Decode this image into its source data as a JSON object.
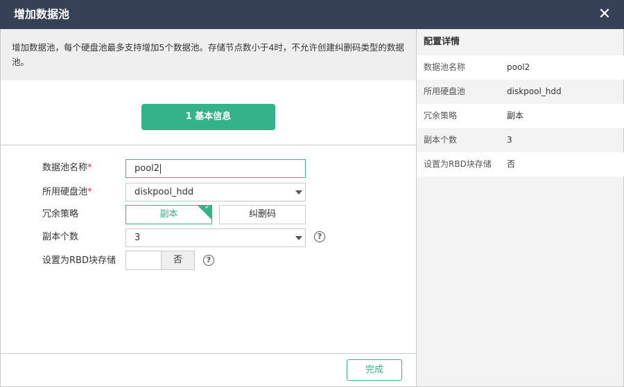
{
  "dialog": {
    "title": "增加数据池",
    "close_icon": "✕"
  },
  "notice": {
    "text": "增加数据池，每个硬盘池最多支持增加5个数据池。存储节点数小于4时，不允许创建纠删码类型的数据池。"
  },
  "step": {
    "label": "1 基本信息"
  },
  "form": {
    "pool_name": {
      "label": "数据池名称",
      "required_mark": "*",
      "value": "pool2"
    },
    "disk_pool": {
      "label": "所用硬盘池",
      "required_mark": "*",
      "value": "diskpool_hdd"
    },
    "redundancy": {
      "label": "冗余策略",
      "options": [
        "副本",
        "纠删码"
      ],
      "selected": "副本"
    },
    "replica_count": {
      "label": "副本个数",
      "value": "3",
      "help_icon": "?"
    },
    "rbd": {
      "label": "设置为RBD块存储",
      "value": "否",
      "help_icon": "?"
    }
  },
  "footer": {
    "done_label": "完成"
  },
  "details": {
    "header": "配置详情",
    "rows": [
      {
        "key": "数据池名称",
        "value": "pool2"
      },
      {
        "key": "所用硬盘池",
        "value": "diskpool_hdd"
      },
      {
        "key": "冗余策略",
        "value": "副本"
      },
      {
        "key": "副本个数",
        "value": "3"
      },
      {
        "key": "设置为RBD块存储",
        "value": "否"
      }
    ]
  },
  "colors": {
    "titlebar": "#354155",
    "accent": "#34b38a",
    "required": "#e52a2a",
    "panel_bg": "#f3f3f3",
    "notice_bg": "#efefef"
  }
}
